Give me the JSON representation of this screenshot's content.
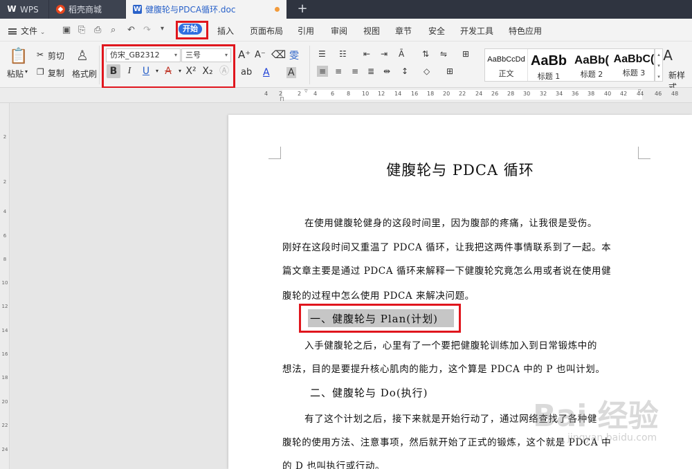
{
  "tabs": {
    "wps": "WPS",
    "shop": "稻壳商城",
    "doc": "健腹轮与PDCA循环.doc",
    "plus": "+"
  },
  "menu": {
    "file": "文件",
    "items": [
      "开始",
      "插入",
      "页面布局",
      "引用",
      "审阅",
      "视图",
      "章节",
      "安全",
      "开发工具",
      "特色应用"
    ]
  },
  "ribbon": {
    "paste": "粘贴",
    "cut": "剪切",
    "copy": "复制",
    "format_painter": "格式刷",
    "font_name": "仿宋_GB2312",
    "font_size": "三号",
    "new_style": "新样式",
    "styles": [
      {
        "sample": "AaBbCcDd",
        "label": "正文"
      },
      {
        "sample": "AaBb",
        "label": "标题 1"
      },
      {
        "sample": "AaBb(",
        "label": "标题 2"
      },
      {
        "sample": "AaBbC(",
        "label": "标题 3"
      }
    ]
  },
  "ruler": {
    "ticks": [
      "4",
      "2",
      "2",
      "4",
      "6",
      "8",
      "10",
      "12",
      "14",
      "16",
      "18",
      "20",
      "22",
      "24",
      "26",
      "28",
      "30",
      "32",
      "34",
      "36",
      "38",
      "40",
      "42",
      "44",
      "46",
      "48"
    ],
    "vticks": [
      "2",
      "2",
      "4",
      "6",
      "8",
      "10",
      "12",
      "14",
      "16",
      "18",
      "20",
      "22",
      "24"
    ]
  },
  "document": {
    "title": "健腹轮与 PDCA 循环",
    "intro_lines": [
      "在使用健腹轮健身的这段时间里，因为腹部的疼痛，让我很是受伤。",
      "刚好在这段时间又重温了 PDCA 循环，让我把这两件事情联系到了一起。本",
      "篇文章主要是通过 PDCA 循环来解释一下健腹轮究竟怎么用或者说在使用健",
      "腹轮的过程中怎么使用 PDCA 来解决问题。"
    ],
    "heading1": "一、健腹轮与 Plan(计划)",
    "section1_lines": [
      "入手健腹轮之后，心里有了一个要把健腹轮训练加入到日常锻炼中的",
      "想法，目的是要提升核心肌肉的能力，这个算是 PDCA 中的 P 也叫计划。"
    ],
    "heading2": "二、健腹轮与 Do(执行)",
    "section2_lines": [
      "有了这个计划之后，接下来就是开始行动了，通过网络查找了各种健",
      "腹轮的使用方法、注意事项，然后就开始了正式的锻炼，这个就是 PDCA 中",
      "的 D 也叫执行或行动。"
    ]
  },
  "watermark": {
    "text": "Bai 经验",
    "sub": "jingyan.baidu.com"
  },
  "colors": {
    "highlight": "#e0161d",
    "accent": "#2f6fe0"
  }
}
